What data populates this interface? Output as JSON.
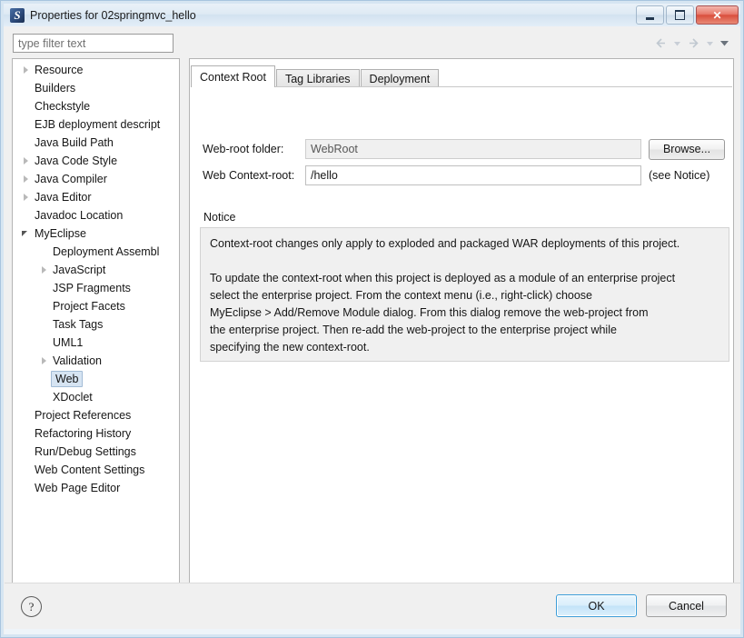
{
  "window": {
    "title": "Properties for 02springmvc_hello",
    "icon": "myeclipse-icon",
    "controls": {
      "minimize": "minimize-icon",
      "maximize": "maximize-icon",
      "close": "close-icon"
    }
  },
  "filter": {
    "placeholder": "type filter text",
    "value": ""
  },
  "nav": {
    "back": "back-arrow-icon",
    "back_menu": "back-dropdown-icon",
    "forward": "forward-arrow-icon",
    "forward_menu": "forward-dropdown-icon",
    "more": "view-menu-icon"
  },
  "tree": {
    "items": [
      {
        "label": "Resource",
        "indent": 0,
        "twisty": "collapsed",
        "selected": false
      },
      {
        "label": "Builders",
        "indent": 0,
        "twisty": "none",
        "selected": false
      },
      {
        "label": "Checkstyle",
        "indent": 0,
        "twisty": "none",
        "selected": false
      },
      {
        "label": "EJB deployment descript",
        "indent": 0,
        "twisty": "none",
        "selected": false
      },
      {
        "label": "Java Build Path",
        "indent": 0,
        "twisty": "none",
        "selected": false
      },
      {
        "label": "Java Code Style",
        "indent": 0,
        "twisty": "collapsed",
        "selected": false
      },
      {
        "label": "Java Compiler",
        "indent": 0,
        "twisty": "collapsed",
        "selected": false
      },
      {
        "label": "Java Editor",
        "indent": 0,
        "twisty": "collapsed",
        "selected": false
      },
      {
        "label": "Javadoc Location",
        "indent": 0,
        "twisty": "none",
        "selected": false
      },
      {
        "label": "MyEclipse",
        "indent": 0,
        "twisty": "expanded",
        "selected": false
      },
      {
        "label": "Deployment Assembl",
        "indent": 1,
        "twisty": "none",
        "selected": false
      },
      {
        "label": "JavaScript",
        "indent": 1,
        "twisty": "collapsed",
        "selected": false
      },
      {
        "label": "JSP Fragments",
        "indent": 1,
        "twisty": "none",
        "selected": false
      },
      {
        "label": "Project Facets",
        "indent": 1,
        "twisty": "none",
        "selected": false
      },
      {
        "label": "Task Tags",
        "indent": 1,
        "twisty": "none",
        "selected": false
      },
      {
        "label": "UML1",
        "indent": 1,
        "twisty": "none",
        "selected": false
      },
      {
        "label": "Validation",
        "indent": 1,
        "twisty": "collapsed",
        "selected": false
      },
      {
        "label": "Web",
        "indent": 1,
        "twisty": "none",
        "selected": true
      },
      {
        "label": "XDoclet",
        "indent": 1,
        "twisty": "none",
        "selected": false
      },
      {
        "label": "Project References",
        "indent": 0,
        "twisty": "none",
        "selected": false
      },
      {
        "label": "Refactoring History",
        "indent": 0,
        "twisty": "none",
        "selected": false
      },
      {
        "label": "Run/Debug Settings",
        "indent": 0,
        "twisty": "none",
        "selected": false
      },
      {
        "label": "Web Content Settings",
        "indent": 0,
        "twisty": "none",
        "selected": false
      },
      {
        "label": "Web Page Editor",
        "indent": 0,
        "twisty": "none",
        "selected": false
      }
    ],
    "scrollbar": {
      "left_arrow": "scroll-left-icon",
      "right_arrow": "scroll-right-icon"
    }
  },
  "tabs": [
    {
      "label": "Context Root",
      "active": true
    },
    {
      "label": "Tag Libraries",
      "active": false
    },
    {
      "label": "Deployment",
      "active": false
    }
  ],
  "form": {
    "webroot_label": "Web-root folder:",
    "webroot_value": "WebRoot",
    "browse_label": "Browse...",
    "context_label": "Web Context-root:",
    "context_value": "/hello",
    "context_note": "(see Notice)"
  },
  "notice": {
    "title": "Notice",
    "body": "Context-root changes only apply to exploded and packaged WAR deployments of this project.\n\nTo update the context-root when this project is deployed as a module of an enterprise project\nselect the enterprise project. From the context menu (i.e., right-click) choose\nMyEclipse > Add/Remove Module dialog. From this dialog remove the web-project from\nthe enterprise project. Then re-add the web-project to the enterprise project while\nspecifying the new context-root."
  },
  "footer": {
    "help": "?",
    "ok_label": "OK",
    "cancel_label": "Cancel"
  },
  "colors": {
    "accent": "#3c9dd8",
    "selection": "#d6e4f2",
    "close_button": "#d94f3d",
    "notice_bg": "#f0f0f0"
  }
}
